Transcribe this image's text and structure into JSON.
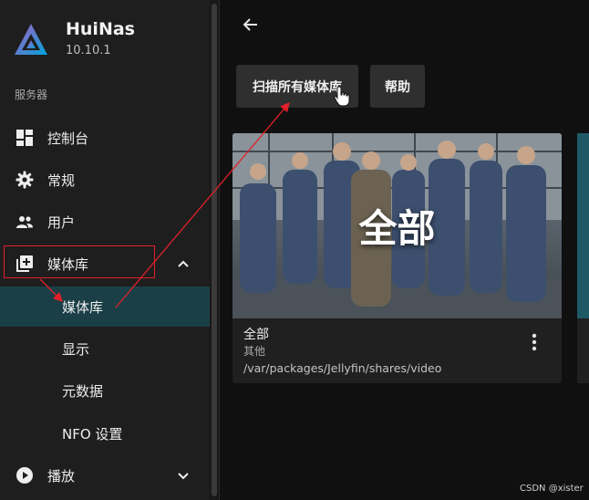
{
  "app": {
    "name": "HuiNas",
    "version": "10.10.1",
    "accent_color": "#1b3f47",
    "highlight_color": "#e0202a"
  },
  "sidebar": {
    "section_label": "服务器",
    "items": [
      {
        "label": "控制台",
        "icon": "dashboard-icon"
      },
      {
        "label": "常规",
        "icon": "gear-icon"
      },
      {
        "label": "用户",
        "icon": "users-icon"
      },
      {
        "label": "媒体库",
        "icon": "library-add-icon",
        "expanded": true,
        "children": [
          {
            "label": "媒体库",
            "active": true
          },
          {
            "label": "显示"
          },
          {
            "label": "元数据"
          },
          {
            "label": "NFO 设置"
          }
        ]
      },
      {
        "label": "播放",
        "icon": "play-icon",
        "expanded": false
      }
    ]
  },
  "main": {
    "back_icon": "arrow-left-icon",
    "buttons": {
      "scan_all": "扫描所有媒体库",
      "help": "帮助"
    },
    "library_card": {
      "overlay_title": "全部",
      "name": "全部",
      "type": "其他",
      "path": "/var/packages/Jellyfin/shares/video",
      "menu_icon": "more-vertical-icon"
    }
  },
  "watermark": "CSDN @xister"
}
